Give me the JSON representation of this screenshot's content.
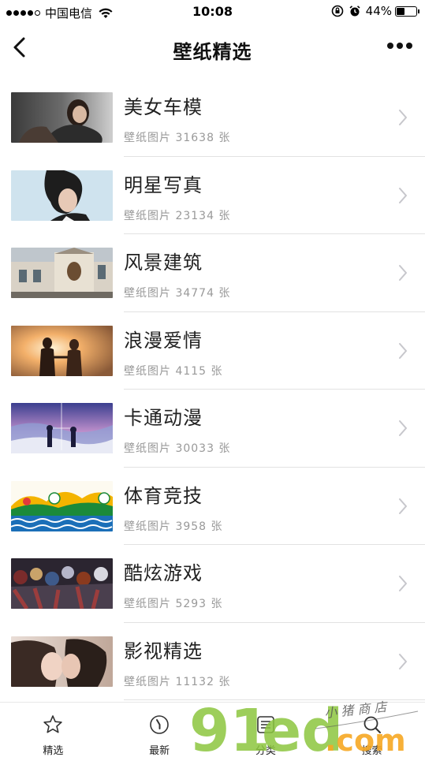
{
  "status": {
    "carrier": "中国电信",
    "time": "10:08",
    "battery_text": "44%",
    "battery_level": 0.44
  },
  "nav": {
    "title": "壁纸精选"
  },
  "items": [
    {
      "title": "美女车模",
      "sub": "壁纸图片 31638 张",
      "thumb": "portrait"
    },
    {
      "title": "明星写真",
      "sub": "壁纸图片 23134 张",
      "thumb": "celebrity"
    },
    {
      "title": "风景建筑",
      "sub": "壁纸图片 34774 张",
      "thumb": "architecture"
    },
    {
      "title": "浪漫爱情",
      "sub": "壁纸图片 4115 张",
      "thumb": "sunset-couple"
    },
    {
      "title": "卡通动漫",
      "sub": "壁纸图片 30033 张",
      "thumb": "anime-sky"
    },
    {
      "title": "体育竞技",
      "sub": "壁纸图片 3958 张",
      "thumb": "olympic-rio"
    },
    {
      "title": "酷炫游戏",
      "sub": "壁纸图片 5293 张",
      "thumb": "game-heroes"
    },
    {
      "title": "影视精选",
      "sub": "壁纸图片 11132 张",
      "thumb": "movie-kiss"
    }
  ],
  "tabs": [
    {
      "label": "精选",
      "icon": "star-icon"
    },
    {
      "label": "最新",
      "icon": "clock-icon"
    },
    {
      "label": "分类",
      "icon": "list-icon"
    },
    {
      "label": "搜索",
      "icon": "search-icon"
    }
  ],
  "watermark": {
    "main": "91",
    "mid": "ed",
    "dot": ".com",
    "script": "小 猪 商 店"
  },
  "colors": {
    "watermark_green": "#8cc63f",
    "watermark_orange": "#f7a823",
    "divider": "#e2e2e2",
    "subtext": "#999999"
  }
}
